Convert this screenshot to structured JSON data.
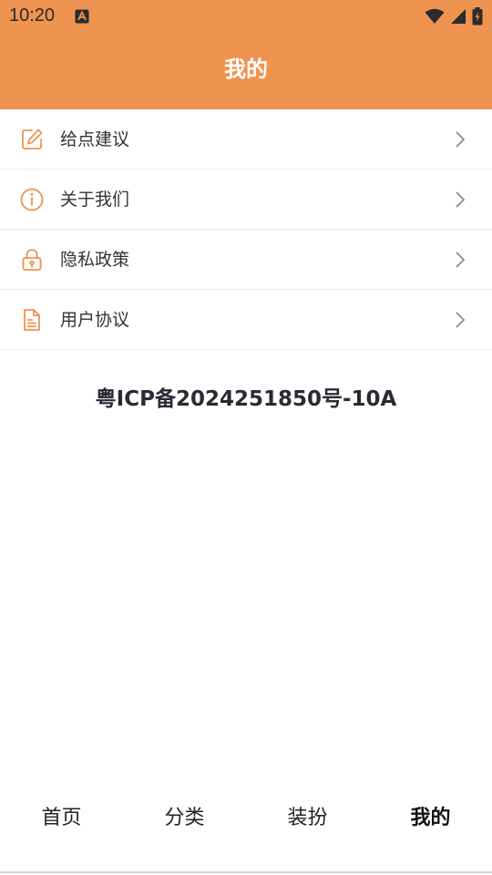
{
  "status_bar": {
    "time": "10:20",
    "app_icon": "a-letter-icon",
    "icons": [
      "wifi-icon",
      "signal-icon",
      "battery-charging-icon"
    ]
  },
  "header": {
    "title": "我的",
    "background": "#EF9350"
  },
  "menu": {
    "items": [
      {
        "label": "给点建议",
        "icon": "edit-icon"
      },
      {
        "label": "关于我们",
        "icon": "info-icon"
      },
      {
        "label": "隐私政策",
        "icon": "lock-icon"
      },
      {
        "label": "用户协议",
        "icon": "document-icon"
      }
    ],
    "icon_color": "#EF9350"
  },
  "icp": "粤ICP备2024251850号-10A",
  "bottom_nav": {
    "items": [
      {
        "label": "首页"
      },
      {
        "label": "分类"
      },
      {
        "label": "装扮"
      },
      {
        "label": "我的"
      }
    ],
    "active_index": 3
  }
}
